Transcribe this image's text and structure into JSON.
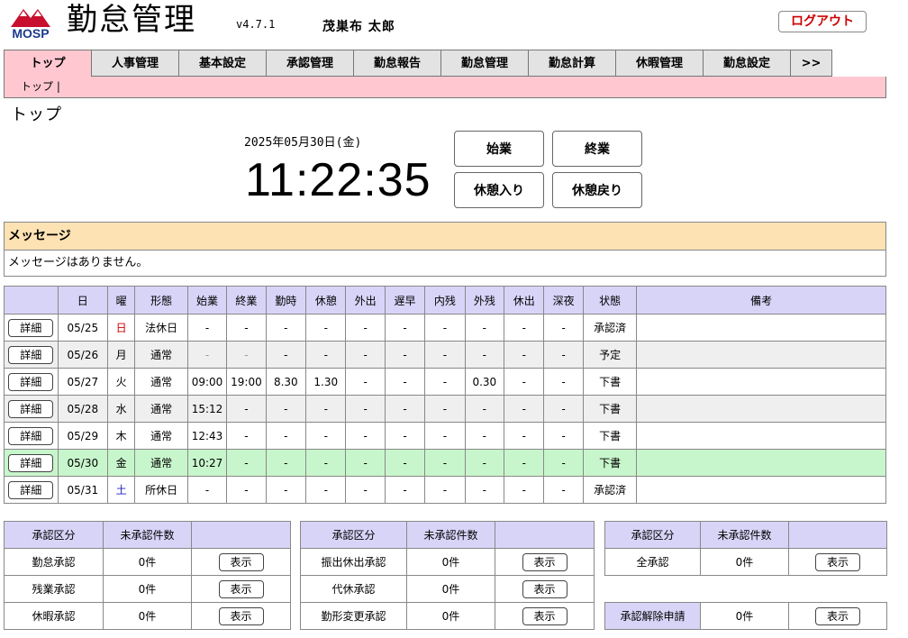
{
  "header": {
    "logo_text": "MOSP",
    "title": "勤怠管理",
    "version": "v4.7.1",
    "user_name": "茂巣布 太郎",
    "logout_label": "ログアウト"
  },
  "nav": {
    "tabs": [
      "トップ",
      "人事管理",
      "基本設定",
      "承認管理",
      "勤怠報告",
      "勤怠管理",
      "勤怠計算",
      "休暇管理",
      "勤怠設定"
    ],
    "more_label": ">>",
    "breadcrumb": "トップ |"
  },
  "page": {
    "title": "トップ"
  },
  "clock": {
    "date": "2025年05月30日(金)",
    "time": "11:22:35",
    "buttons": {
      "start": "始業",
      "end": "終業",
      "break_in": "休憩入り",
      "break_out": "休憩戻り"
    }
  },
  "messages": {
    "header": "メッセージ",
    "body": "メッセージはありません。"
  },
  "attendance": {
    "headers": [
      "",
      "日",
      "曜",
      "形態",
      "始業",
      "終業",
      "勤時",
      "休憩",
      "外出",
      "遅早",
      "内残",
      "外残",
      "休出",
      "深夜",
      "状態",
      "備考"
    ],
    "detail_label": "詳細",
    "rows": [
      {
        "date": "05/25",
        "dow": "日",
        "type": "法休日",
        "start": "-",
        "end": "-",
        "work": "-",
        "brk": "-",
        "out": "-",
        "late": "-",
        "inner": "-",
        "outer": "-",
        "holiday": "-",
        "night": "-",
        "status": "承認済",
        "note": ""
      },
      {
        "date": "05/26",
        "dow": "月",
        "type": "通常",
        "start": "-",
        "end": "-",
        "work": "-",
        "brk": "-",
        "out": "-",
        "late": "-",
        "inner": "-",
        "outer": "-",
        "holiday": "-",
        "night": "-",
        "status": "予定",
        "note": ""
      },
      {
        "date": "05/27",
        "dow": "火",
        "type": "通常",
        "start": "09:00",
        "end": "19:00",
        "work": "8.30",
        "brk": "1.30",
        "out": "-",
        "late": "-",
        "inner": "-",
        "outer": "0.30",
        "holiday": "-",
        "night": "-",
        "status": "下書",
        "note": ""
      },
      {
        "date": "05/28",
        "dow": "水",
        "type": "通常",
        "start": "15:12",
        "end": "-",
        "work": "-",
        "brk": "-",
        "out": "-",
        "late": "-",
        "inner": "-",
        "outer": "-",
        "holiday": "-",
        "night": "-",
        "status": "下書",
        "note": ""
      },
      {
        "date": "05/29",
        "dow": "木",
        "type": "通常",
        "start": "12:43",
        "end": "-",
        "work": "-",
        "brk": "-",
        "out": "-",
        "late": "-",
        "inner": "-",
        "outer": "-",
        "holiday": "-",
        "night": "-",
        "status": "下書",
        "note": ""
      },
      {
        "date": "05/30",
        "dow": "金",
        "type": "通常",
        "start": "10:27",
        "end": "-",
        "work": "-",
        "brk": "-",
        "out": "-",
        "late": "-",
        "inner": "-",
        "outer": "-",
        "holiday": "-",
        "night": "-",
        "status": "下書",
        "note": ""
      },
      {
        "date": "05/31",
        "dow": "土",
        "type": "所休日",
        "start": "-",
        "end": "-",
        "work": "-",
        "brk": "-",
        "out": "-",
        "late": "-",
        "inner": "-",
        "outer": "-",
        "holiday": "-",
        "night": "-",
        "status": "承認済",
        "note": ""
      }
    ]
  },
  "approvals": {
    "col_category": "承認区分",
    "col_pending": "未承認件数",
    "show_label": "表示",
    "left": [
      {
        "category": "勤怠承認",
        "count": "0件"
      },
      {
        "category": "残業承認",
        "count": "0件"
      },
      {
        "category": "休暇承認",
        "count": "0件"
      }
    ],
    "middle": [
      {
        "category": "振出休出承認",
        "count": "0件"
      },
      {
        "category": "代休承認",
        "count": "0件"
      },
      {
        "category": "勤形変更承認",
        "count": "0件"
      }
    ],
    "right": [
      {
        "category": "全承認",
        "count": "0件"
      }
    ],
    "release": {
      "category": "承認解除申請",
      "count": "0件"
    }
  },
  "colors": {
    "nav_active": "#ffc8d0",
    "table_header": "#d8d4f8",
    "message_header": "#fde2b4",
    "today_row": "#c8f6cc",
    "logout_text": "#cc0000",
    "sunday": "#d00000",
    "saturday": "#2020c0"
  }
}
